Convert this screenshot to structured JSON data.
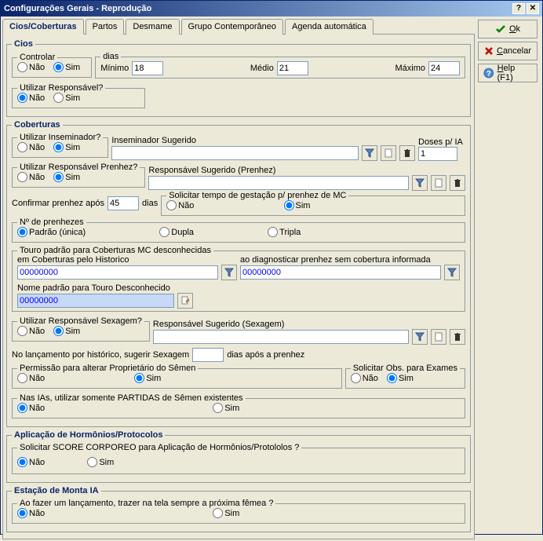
{
  "title": "Configurações Gerais - Reprodução",
  "tabs": {
    "t0": "Cios/Coberturas",
    "t1": "Partos",
    "t2": "Desmame",
    "t3": "Grupo Contemporâneo",
    "t4": "Agenda automática"
  },
  "buttons": {
    "ok": "Ok",
    "cancel": "Cancelar",
    "help": "Help (F1)"
  },
  "common": {
    "nao": "Não",
    "sim": "Sim"
  },
  "cios": {
    "legend": "Cios",
    "controlar": "Controlar",
    "dias": "dias",
    "minimo": "Mínimo",
    "minimo_v": "18",
    "medio": "Médio",
    "medio_v": "21",
    "maximo": "Máximo",
    "maximo_v": "24",
    "utilResp": "Utilizar Responsável?"
  },
  "cob": {
    "legend": "Coberturas",
    "utilInsem": "Utilizar Inseminador?",
    "insemSug": "Inseminador Sugerido",
    "doses": "Doses p/ IA",
    "doses_v": "1",
    "utilRespPren": "Utilizar Responsável Prenhez?",
    "respSugPren": "Responsável Sugerido (Prenhez)",
    "confPren": "Confirmar prenhez após",
    "confPren_v": "45",
    "dias": "dias",
    "solGest": "Solicitar tempo de gestação p/ prenhez de MC",
    "nPren": "Nº de prenhezes",
    "padrao": "Padrão (única)",
    "dupla": "Dupla",
    "tripla": "Tripla",
    "touroLegend": "Touro padrão para Coberturas MC desconhecidas",
    "emCob": "em Coberturas pelo Historico",
    "aoDiag": "ao diagnosticar prenhez sem cobertura informada",
    "touro1": "00000000",
    "touro2": "00000000",
    "nomePadrao": "Nome padrão para Touro Desconhecido",
    "touroNome": "00000000",
    "utilRespSex": "Utilizar Responsável Sexagem?",
    "respSugSex": "Responsável Sugerido (Sexagem)",
    "lancHist1": "No lançamento por histórico, sugerir Sexagem",
    "lancHist2": "dias após a prenhez",
    "permAlt": "Permissão para alterar Proprietário do Sêmen",
    "solObs": "Solicitar Obs. para Exames",
    "nasIAs": "Nas IAs, utilizar somente PARTIDAS de Sêmen existentes"
  },
  "horm": {
    "legend": "Aplicação de Hormônios/Protocolos",
    "q": "Solicitar SCORE CORPOREO para Aplicação de Hormônios/Protololos ?"
  },
  "est": {
    "legend": "Estação de Monta IA",
    "q": "Ao fazer um lançamento, trazer na tela sempre a próxima fêmea ?"
  }
}
